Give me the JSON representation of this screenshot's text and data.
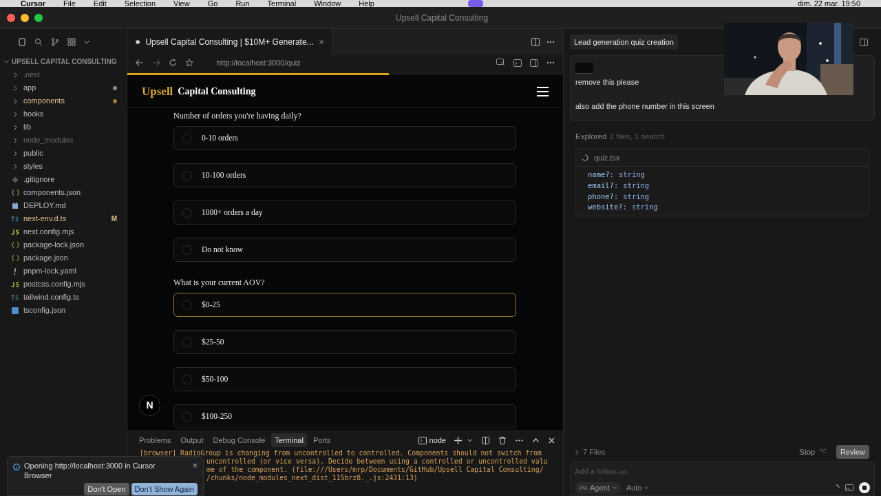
{
  "menu_bar": {
    "app": "Cursor",
    "items": [
      "File",
      "Edit",
      "Selection",
      "View",
      "Go",
      "Run",
      "Terminal",
      "Window",
      "Help"
    ],
    "clock": "dim. 22 mar. 19:50"
  },
  "window": {
    "title": "Upsell Capital Consulting"
  },
  "explorer": {
    "title": "UPSELL CAPITAL CONSULTING",
    "items": [
      {
        "name": ".next",
        "kind": "folder",
        "dimmed": true,
        "modified": false
      },
      {
        "name": "app",
        "kind": "folder",
        "dimmed": false,
        "modified": false,
        "color": "#8a8a8a"
      },
      {
        "name": "components",
        "kind": "folder",
        "dimmed": false,
        "modified": true,
        "color": "#9a7a45"
      },
      {
        "name": "hooks",
        "kind": "folder",
        "dimmed": false,
        "modified": false
      },
      {
        "name": "lib",
        "kind": "folder",
        "dimmed": false,
        "modified": false
      },
      {
        "name": "node_modules",
        "kind": "folder",
        "dimmed": true,
        "modified": false
      },
      {
        "name": "public",
        "kind": "folder",
        "dimmed": false,
        "modified": false
      },
      {
        "name": "styles",
        "kind": "folder",
        "dimmed": false,
        "modified": false
      },
      {
        "name": ".gitignore",
        "kind": "git",
        "dimmed": false,
        "modified": false
      },
      {
        "name": "components.json",
        "kind": "json",
        "dimmed": false,
        "modified": false
      },
      {
        "name": "DEPLOY.md",
        "kind": "md",
        "dimmed": false,
        "modified": false
      },
      {
        "name": "next-env.d.ts",
        "kind": "ts",
        "dimmed": false,
        "modified": true,
        "status": "M"
      },
      {
        "name": "next.config.mjs",
        "kind": "js",
        "dimmed": false,
        "modified": false
      },
      {
        "name": "package-lock.json",
        "kind": "json",
        "dimmed": false,
        "modified": false
      },
      {
        "name": "package.json",
        "kind": "json",
        "dimmed": false,
        "modified": false
      },
      {
        "name": "pnpm-lock.yaml",
        "kind": "yaml",
        "dimmed": false,
        "modified": false
      },
      {
        "name": "postcss.config.mjs",
        "kind": "js",
        "dimmed": false,
        "modified": false
      },
      {
        "name": "tailwind.config.ts",
        "kind": "ts",
        "dimmed": false,
        "modified": false
      },
      {
        "name": "tsconfig.json",
        "kind": "tsconfig",
        "dimmed": false,
        "modified": false
      }
    ]
  },
  "browser": {
    "tab_title": "Upsell Capital Consulting | $10M+ Generate...",
    "url": "http://localhost:3000/quiz",
    "loading": {
      "level": 0.6
    },
    "page": {
      "logo_accent": "Upsell",
      "logo_rest": "Capital Consulting",
      "questions": [
        {
          "label": "Number of orders you're having daily?",
          "options": [
            {
              "label": "0-10 orders",
              "selected": false,
              "highlighted": false
            },
            {
              "label": "10-100 orders",
              "selected": false,
              "highlighted": false
            },
            {
              "label": "1000+ orders a day",
              "selected": false,
              "highlighted": false
            },
            {
              "label": "Do not know",
              "selected": false,
              "highlighted": false
            }
          ]
        },
        {
          "label": "What is your current AOV?",
          "options": [
            {
              "label": "$0-25",
              "selected": false,
              "highlighted": true
            },
            {
              "label": "$25-50",
              "selected": false,
              "highlighted": false
            },
            {
              "label": "$50-100",
              "selected": false,
              "highlighted": false
            },
            {
              "label": "$100-250",
              "selected": false,
              "highlighted": false
            }
          ]
        }
      ],
      "dev_badge": "N"
    }
  },
  "panel": {
    "tabs": [
      {
        "label": "Problems",
        "selected": false
      },
      {
        "label": "Output",
        "selected": false
      },
      {
        "label": "Debug Console",
        "selected": false
      },
      {
        "label": "Terminal",
        "selected": true
      },
      {
        "label": "Ports",
        "selected": false
      }
    ],
    "shell": "node",
    "lines": [
      {
        "text": "[browser] RadioGroup is changing from uncontrolled to controlled. Components should not switch from",
        "kind": "full"
      },
      {
        "text": "uncontrolled (or vice versa). Decide between using a controlled or uncontrolled valu",
        "kind": "covered"
      },
      {
        "text": "me of the component. (file:///Users/mrp/Documents/GitHub/Upsell Capital Consulting/",
        "kind": "covered"
      },
      {
        "text": "/chunks/node_modules_next_dist_115brz8._.js:2431:13)",
        "kind": "covered"
      }
    ]
  },
  "toast": {
    "message": "Opening http://localhost:3000 in Cursor Browser",
    "close": "×",
    "buttons": [
      {
        "label": "Don't Open",
        "primary": false
      },
      {
        "label": "Don't Show Again",
        "primary": true
      }
    ]
  },
  "chat": {
    "title": "Lead generation quiz creation",
    "message": [
      "remove this please",
      "also add the phone number in this screen"
    ],
    "explored": {
      "label": "Explored",
      "detail": "2 files, 1 search"
    },
    "file": {
      "name": "quiz.tsx",
      "code": [
        {
          "key": "name?:",
          "type": "string"
        },
        {
          "key": "email?:",
          "type": "string"
        },
        {
          "key": "phone?:",
          "type": "string"
        },
        {
          "key": "website?:",
          "type": "string"
        }
      ]
    },
    "files_summary": "7 Files",
    "stop": "Stop",
    "stop_shortcut": "^C",
    "review": "Review",
    "input": {
      "placeholder": "Add a follow-up"
    },
    "mode": "Agent",
    "model": "Auto"
  }
}
